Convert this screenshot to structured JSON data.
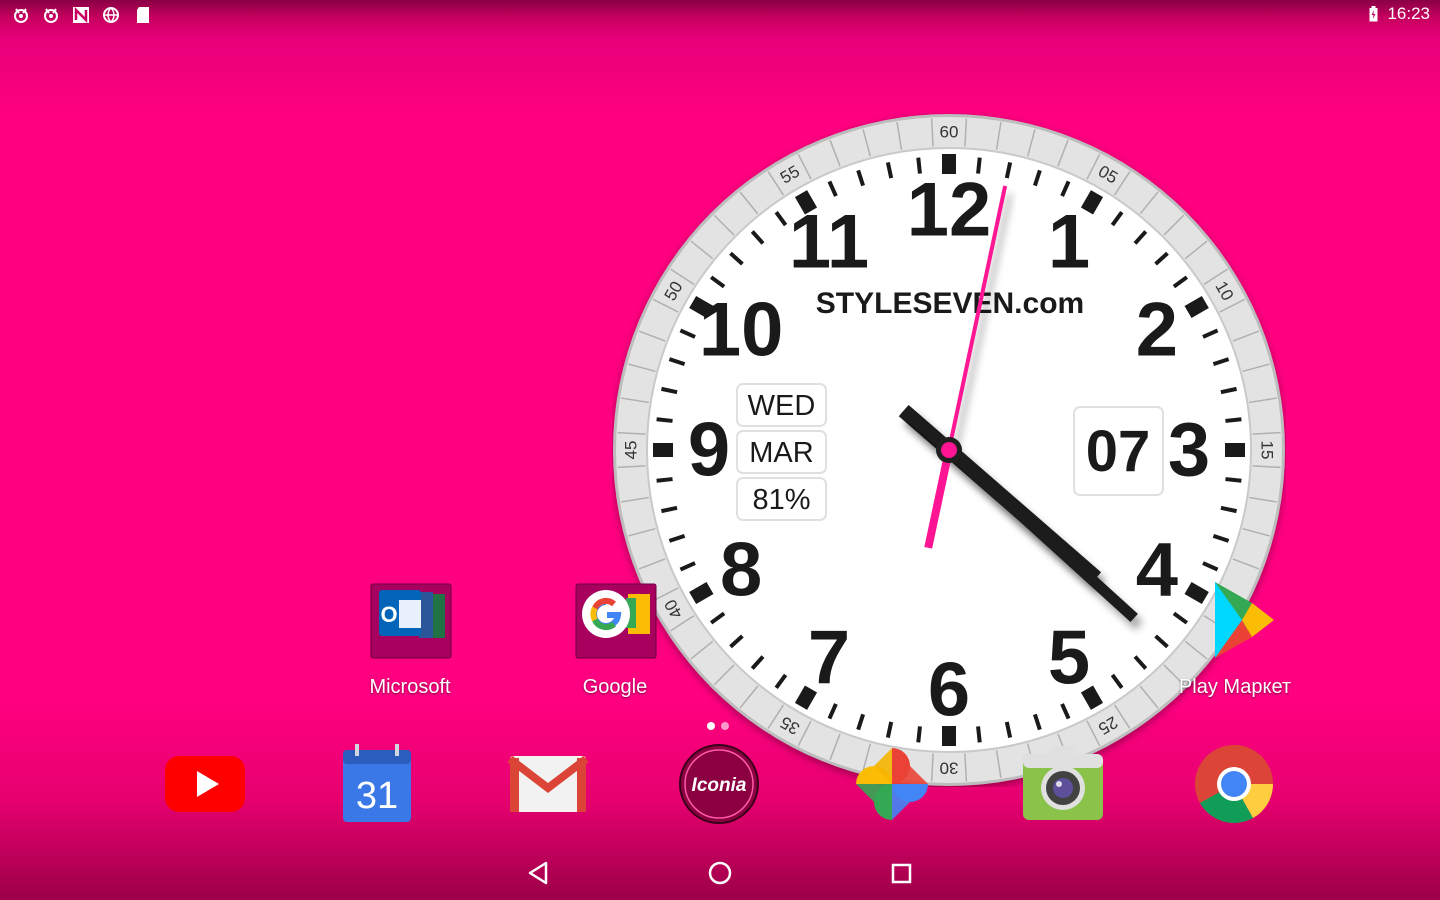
{
  "status_bar": {
    "time": "16:23",
    "left_icons": [
      "app-notification-icon",
      "app-notification-icon",
      "n-icon",
      "globe-icon",
      "sd-card-icon"
    ],
    "battery_icon": "battery-charging-icon"
  },
  "clock_widget": {
    "brand": "STYLESEVEN.com",
    "hour_numerals": [
      "12",
      "1",
      "2",
      "3",
      "4",
      "5",
      "6",
      "7",
      "8",
      "9",
      "10",
      "11"
    ],
    "minute_labels": [
      "60",
      "05",
      "10",
      "15",
      "20",
      "25",
      "30",
      "35",
      "40",
      "45",
      "50",
      "55"
    ],
    "weekday": "WED",
    "month": "MAR",
    "battery": "81%",
    "day": "07",
    "time_shown": {
      "hours": 16,
      "minutes": 22,
      "seconds": 2
    },
    "colors": {
      "face": "#ffffff",
      "bezel": "#d8d8d8",
      "hands": "#1f1f1f",
      "second_hand": "#ff1493"
    }
  },
  "home_apps": [
    {
      "label": "Microsoft"
    },
    {
      "label": "Google"
    },
    {
      "label": "Play Маркет"
    }
  ],
  "page_indicator": {
    "pages": 2,
    "current": 1
  },
  "dock": [
    {
      "name": "youtube"
    },
    {
      "name": "calendar",
      "text": "31"
    },
    {
      "name": "gmail"
    },
    {
      "name": "iconia",
      "text": "Iconia"
    },
    {
      "name": "photos"
    },
    {
      "name": "camera"
    },
    {
      "name": "chrome"
    }
  ],
  "nav_bar": [
    "back-icon",
    "home-icon",
    "recents-icon"
  ],
  "colors": {
    "wallpaper": "#ff0080"
  }
}
